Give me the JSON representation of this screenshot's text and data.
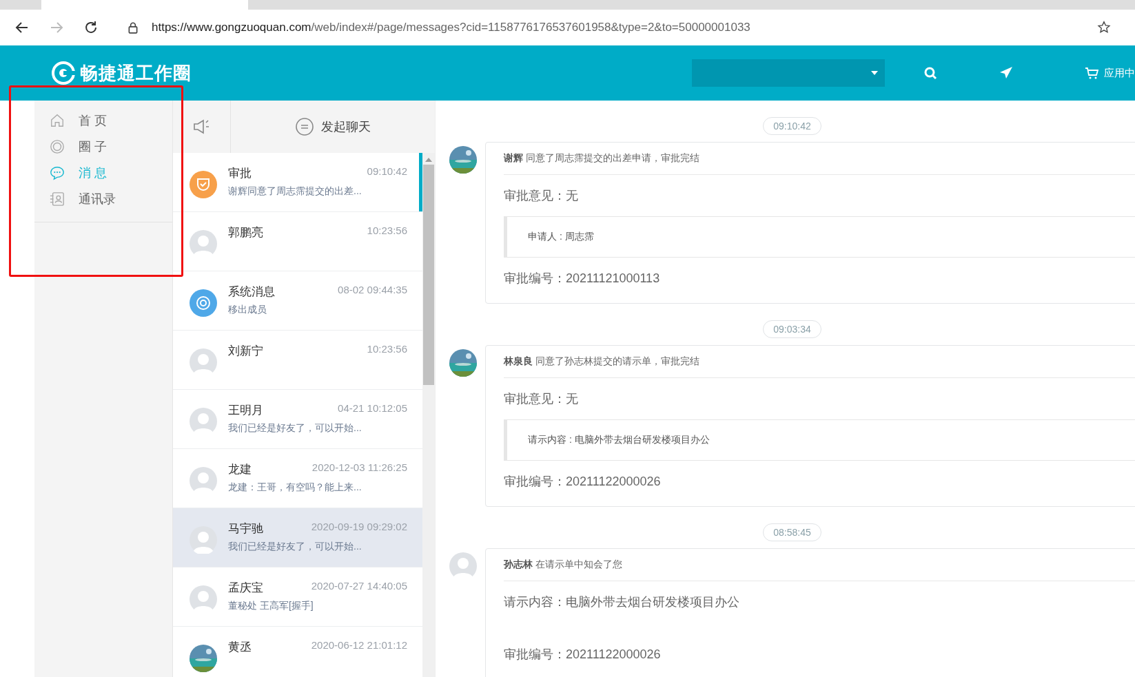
{
  "browser": {
    "url_host": "https://www.gongzuoquan.com",
    "url_path": "/web/index#/page/messages?cid=1158776176537601958&type=2&to=50000001033"
  },
  "header": {
    "logo": "畅捷通工作圈",
    "apps_label": "应用中"
  },
  "annotation": {
    "kind": "red-frame"
  },
  "nav": [
    {
      "label": "首 页",
      "kind": "home",
      "selected": false
    },
    {
      "label": "圈 子",
      "kind": "circle",
      "selected": false
    },
    {
      "label": "消 息",
      "kind": "chat",
      "selected": true
    },
    {
      "label": "通讯录",
      "kind": "contacts",
      "selected": false
    }
  ],
  "chat_list": {
    "new_chat": "发起聊天",
    "items": [
      {
        "name": "审批",
        "time": "09:10:42",
        "preview": "谢辉同意了周志霈提交的出差...",
        "kind": "approval",
        "selected": true,
        "highlighted": false
      },
      {
        "name": "郭鹏亮",
        "time": "10:23:56",
        "kind": "person",
        "selected": false,
        "highlighted": false
      },
      {
        "name": "系统消息",
        "time": "08-02 09:44:35",
        "preview": "移出成员",
        "kind": "system",
        "selected": false,
        "highlighted": false
      },
      {
        "name": "刘新宁",
        "time": "10:23:56",
        "kind": "person",
        "selected": false,
        "highlighted": false
      },
      {
        "name": "王明月",
        "time": "04-21 10:12:05",
        "preview": "我们已经是好友了，可以开始...",
        "kind": "person",
        "selected": false,
        "highlighted": false
      },
      {
        "name": "龙建",
        "time": "2020-12-03 11:26:25",
        "preview": "龙建：王哥，有空吗？能上来...",
        "kind": "person",
        "selected": false,
        "highlighted": false
      },
      {
        "name": "马宇驰",
        "time": "2020-09-19 09:29:02",
        "preview": "我们已经是好友了，可以开始...",
        "kind": "person",
        "selected": false,
        "highlighted": true
      },
      {
        "name": "孟庆宝",
        "time": "2020-07-27 14:40:05",
        "preview": "董秘处 王高军[握手]",
        "kind": "person",
        "selected": false,
        "highlighted": false
      },
      {
        "name": "黄丞",
        "time": "2020-06-12 21:01:12",
        "selected": false,
        "highlighted": false
      }
    ]
  },
  "messages": [
    {
      "time": "09:10:42",
      "author": "谢辉",
      "action": "同意了周志霈提交的出差申请，审批完结",
      "fields": [
        {
          "kind": "line",
          "text": "审批意见：无"
        },
        {
          "kind": "quote",
          "text": "申请人 : 周志霈"
        },
        {
          "kind": "line",
          "text": "审批编号：20211121000113"
        }
      ]
    },
    {
      "time": "09:03:34",
      "author": "林泉良",
      "action": "同意了孙志林提交的请示单，审批完结",
      "fields": [
        {
          "kind": "line",
          "text": "审批意见：无"
        },
        {
          "kind": "quote",
          "text": "请示内容 : 电脑外带去烟台研发楼项目办公"
        },
        {
          "kind": "line",
          "text": "审批编号：20211122000026"
        }
      ]
    },
    {
      "time": "08:58:45",
      "author": "孙志林",
      "action": "在请示单中知会了您",
      "kind": "person",
      "fields": [
        {
          "kind": "line",
          "text": "请示内容：电脑外带去烟台研发楼项目办公"
        },
        {
          "kind": "gap"
        },
        {
          "kind": "line",
          "text": "审批编号：20211122000026"
        }
      ]
    }
  ]
}
